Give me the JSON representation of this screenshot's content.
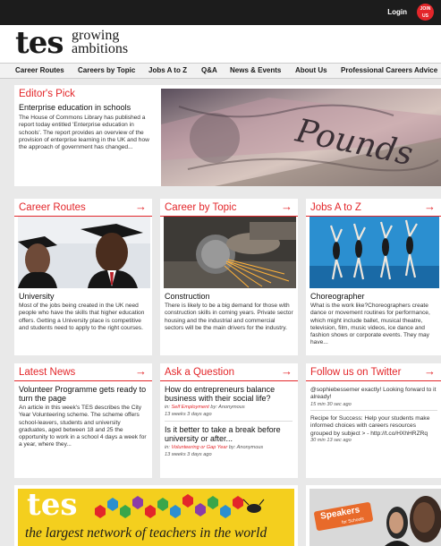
{
  "topbar": {
    "login_label": "Login",
    "join_line1": "JOIN",
    "join_line2": "US"
  },
  "logo": {
    "mark": "tes",
    "tag_line1": "growing",
    "tag_line2": "ambitions"
  },
  "nav": [
    "Career Routes",
    "Careers by Topic",
    "Jobs A to Z",
    "Q&A",
    "News & Events",
    "About Us",
    "Professional Careers Advice"
  ],
  "editors_pick": {
    "title": "Editor's Pick",
    "headline": "Enterprise education in schools",
    "body": "The House of Commons Library has published a report today entitled 'Enterprise education in schools'. The report provides an overview of the provision of enterprise learning in the UK and how the approach of government has changed...",
    "image_text": "Pounds"
  },
  "career_routes": {
    "title": "Career Routes",
    "heading": "University",
    "body": "Most of the jobs being created in the UK need people who have the skills that higher education offers. Getting a University place is competitive and students need to apply to the right courses."
  },
  "career_by_topic": {
    "title": "Career by Topic",
    "heading": "Construction",
    "body": "There is likely to be a big demand for those with construction skills in coming years. Private sector housing and the industrial and commercial sectors will be the main drivers for the industry."
  },
  "jobs_a_to_z": {
    "title": "Jobs A to Z",
    "heading": "Choreographer",
    "body": "What is the work like?Choreographers create dance or movement routines for performance, which might include ballet, musical theatre, television, film, music videos, ice dance and fashion shows or corporate events. They may have..."
  },
  "latest_news": {
    "title": "Latest News",
    "headline": "Volunteer Programme gets ready to turn the page",
    "body": "An article in this week's TES describes the City Year Volunteering scheme. The scheme offers school-leavers, students and university graduates, aged between 18 and 25 the opportunity to work in a school 4 days a week for a year, where they..."
  },
  "ask_question": {
    "title": "Ask a Question",
    "q1": "How do entrepreneurs balance business with their social life?",
    "q1_meta_in": "in:",
    "q1_category": "Self Employment",
    "q1_meta_by": "by: Anonymous",
    "q1_time": "13 weeks 3 days ago",
    "q2": "Is it better to take a break before university or after...",
    "q2_meta_in": "in:",
    "q2_category": "Volunteering or Gap Year",
    "q2_meta_by": "by: Anonymous",
    "q2_time": "13 weeks 3 days ago"
  },
  "twitter": {
    "title": "Follow us on Twitter",
    "tweet1": "@sophiebessemer exactly! Looking forward to it already!",
    "tweet1_time": "15 min 30 sec ago",
    "tweet2": "Recipe for Success: Help your students make informed choices with careers resources grouped by subject > - http://t.co/HXhHRZRq",
    "tweet2_time": "30 min 13 sec ago"
  },
  "banner": {
    "mark": "tes",
    "tagline": "the largest network of teachers in the world"
  },
  "speakers": {
    "label": "Speakers",
    "sublabel": "for Schools"
  },
  "colors": {
    "accent": "#e3262a",
    "topbar": "#1c1c1c",
    "banner": "#f4cf1e"
  }
}
